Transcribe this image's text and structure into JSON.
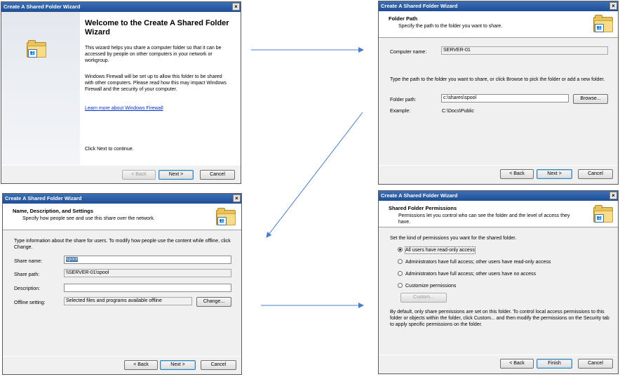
{
  "arrows_color": "#4a7cc9",
  "w1": {
    "title": "Create A Shared Folder Wizard",
    "heading": "Welcome to the Create A Shared Folder Wizard",
    "para1": "This wizard helps you share a computer folder so that it can be accessed by people on other computers in your network or workgroup.",
    "para2": "Windows Firewall will be set up to allow this folder to be shared with other computers. Please read how this may impact Windows Firewall and the security of your computer.",
    "link": "Learn more about Windows Firewall",
    "next_hint": "Click Next to continue.",
    "back": "< Back",
    "next": "Next >",
    "cancel": "Cancel"
  },
  "w2": {
    "title": "Create A Shared Folder Wizard",
    "h_title": "Folder Path",
    "h_sub": "Specify the path to the folder you want to share.",
    "computer_label": "Computer name:",
    "computer_value": "SERVER-01",
    "instructions": "Type the path to the folder you want to share, or click Browse to pick the folder or add a new folder.",
    "path_label": "Folder path:",
    "path_value": "c:\\shares\\spool",
    "browse": "Browse...",
    "example_label": "Example:",
    "example_value": "C:\\Docs\\Public",
    "back": "< Back",
    "next": "Next >",
    "cancel": "Cancel"
  },
  "w3": {
    "title": "Create A Shared Folder Wizard",
    "h_title": "Name, Description, and Settings",
    "h_sub": "Specify how people see and use this share over the network.",
    "instructions": "Type information about the share for users. To modify how people use the content while offline, click Change.",
    "share_name_label": "Share name:",
    "share_name_value": "spool",
    "share_path_label": "Share path:",
    "share_path_value": "\\\\SERVER-01\\spool",
    "description_label": "Description:",
    "description_value": "",
    "offline_label": "Offline setting:",
    "offline_value": "Selected files and programs available offline",
    "change": "Change...",
    "back": "< Back",
    "next": "Next >",
    "cancel": "Cancel"
  },
  "w4": {
    "title": "Create A Shared Folder Wizard",
    "h_title": "Shared Folder Permissions",
    "h_sub": "Permissions let you control who can see the folder and the level of access they have.",
    "instructions": "Set the kind of permissions you want for the shared folder.",
    "options": [
      "All users have read-only access",
      "Administrators have full access; other users have read-only access",
      "Administrators have full access; other users have no access",
      "Customize permissions"
    ],
    "selected_option": 0,
    "custom": "Custom...",
    "footnote": "By default, only share permissions are set on this folder. To control local access permissions to this folder or objects within the folder, click Custom... and then modify the permissions on the Security tab to apply specific permissions on the folder.",
    "back": "< Back",
    "finish": "Finish",
    "cancel": "Cancel"
  }
}
